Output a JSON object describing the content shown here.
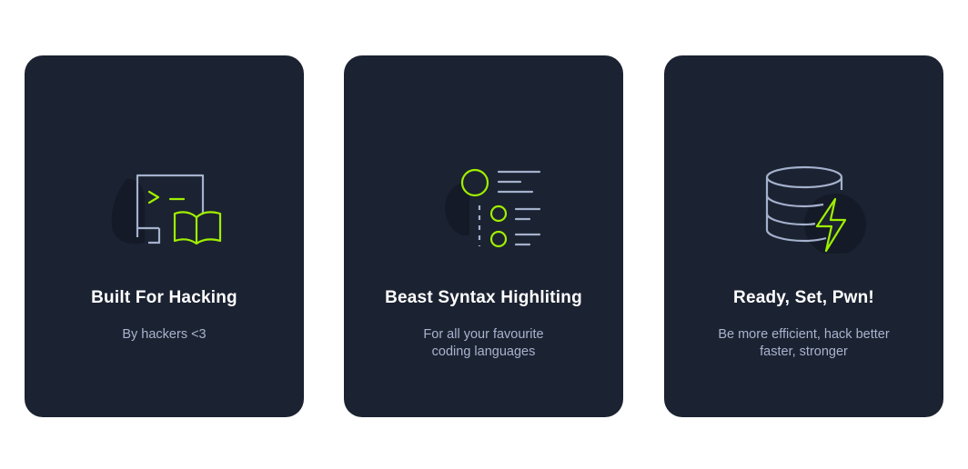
{
  "colors": {
    "page_background": "#ffffff",
    "card_background": "#1b2231",
    "accent": "#9fef00",
    "icon_outline": "#a4b1cd",
    "icon_shadow": "#141a27",
    "title": "#ffffff",
    "description": "#a9b3ce"
  },
  "cards": [
    {
      "icon": "terminal-book-icon",
      "title": "Built For Hacking",
      "description_lines": [
        "By hackers <3"
      ]
    },
    {
      "icon": "syntax-highlight-list-icon",
      "title": "Beast Syntax Highliting",
      "description_lines": [
        "For all your favourite",
        "coding languages"
      ]
    },
    {
      "icon": "database-lightning-icon",
      "title": "Ready, Set, Pwn!",
      "description_lines": [
        "Be more efficient, hack better",
        "faster, stronger"
      ]
    }
  ]
}
